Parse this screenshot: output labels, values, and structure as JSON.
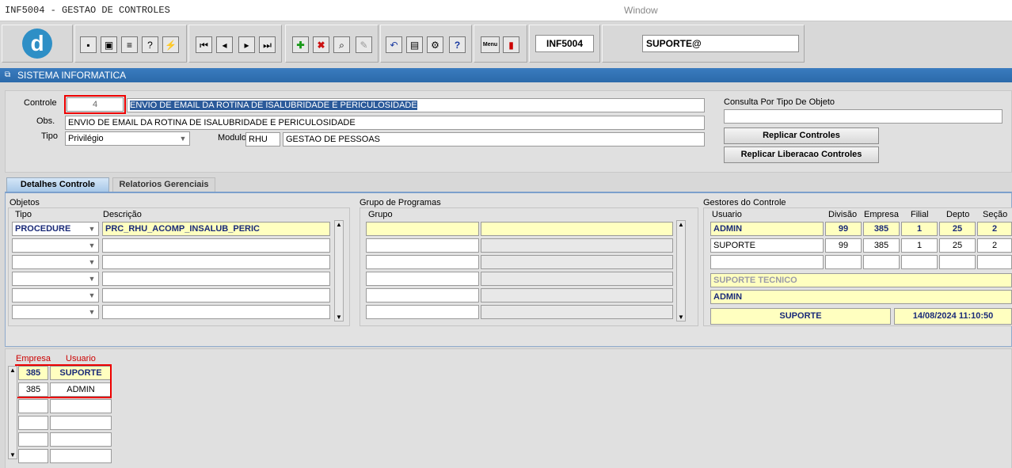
{
  "window": {
    "app_title": "INF5004 - GESTAO DE CONTROLES",
    "window_label": "Window"
  },
  "toolbar": {
    "logo_letter": "d",
    "form_code": "INF5004",
    "user_field": "SUPORTE@",
    "menu_label": "Menu"
  },
  "banner": {
    "title": "SISTEMA INFORMATICA"
  },
  "header": {
    "controle_label": "Controle",
    "controle_value": "4",
    "controle_desc": "ENVIO DE EMAIL DA ROTINA DE ISALUBRIDADE E PERICULOSIDADE",
    "obs_label": "Obs.",
    "obs_value": "ENVIO DE EMAIL DA ROTINA DE ISALUBRIDADE E PERICULOSIDADE",
    "tipo_label": "Tipo",
    "tipo_value": "Privilégio",
    "modulo_label": "Modulo",
    "modulo_code": "RHU",
    "modulo_desc": "GESTAO DE PESSOAS",
    "consulta_label": "Consulta Por Tipo De Objeto",
    "consulta_value": "",
    "replicar_controles": "Replicar Controles",
    "replicar_liberacao": "Replicar Liberacao Controles"
  },
  "tabs": [
    {
      "label": "Detalhes Controle"
    },
    {
      "label": "Relatorios Gerenciais"
    }
  ],
  "objetos": {
    "title": "Objetos",
    "col_tipo": "Tipo",
    "col_descricao": "Descrição",
    "rows": [
      {
        "tipo": "PROCEDURE",
        "descricao": "PRC_RHU_ACOMP_INSALUB_PERIC"
      }
    ]
  },
  "grupo": {
    "title": "Grupo de Programas",
    "col_grupo": "Grupo"
  },
  "gestores": {
    "title": "Gestores do Controle",
    "cols": {
      "usuario": "Usuario",
      "divisao": "Divisão",
      "empresa": "Empresa",
      "filial": "Filial",
      "depto": "Depto",
      "secao": "Seção"
    },
    "rows": [
      {
        "usuario": "ADMIN",
        "divisao": "99",
        "empresa": "385",
        "filial": "1",
        "depto": "25",
        "secao": "2"
      },
      {
        "usuario": "SUPORTE",
        "divisao": "99",
        "empresa": "385",
        "filial": "1",
        "depto": "25",
        "secao": "2"
      }
    ],
    "info_setor": "SUPORTE TECNICO",
    "info_user": "ADMIN",
    "footer_user": "SUPORTE",
    "footer_datetime": "14/08/2024 11:10:50"
  },
  "liberacao": {
    "col_empresa": "Empresa",
    "col_usuario": "Usuario",
    "rows": [
      {
        "empresa": "385",
        "usuario": "SUPORTE"
      },
      {
        "empresa": "385",
        "usuario": "ADMIN"
      }
    ]
  },
  "colors": {
    "banner": "#2b6aaa",
    "highlight": "#ffffc0",
    "red_box": "#ee0000",
    "header_red": "#cc0000",
    "navy_text": "#1a2a78"
  }
}
